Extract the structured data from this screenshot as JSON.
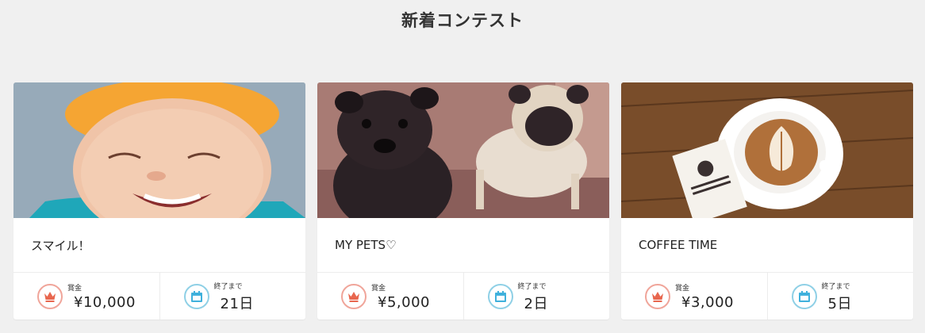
{
  "section_title": "新着コンテスト",
  "contests": [
    {
      "title": "スマイル！",
      "image_icon": "child-smiling-photo",
      "prize_label": "賞金",
      "prize": "¥10,000",
      "deadline_label": "終了まで",
      "deadline": "21日"
    },
    {
      "title": "MY PETS♡",
      "image_icon": "pug-dogs-photo",
      "prize_label": "賞金",
      "prize": "¥5,000",
      "deadline_label": "終了まで",
      "deadline": "2日"
    },
    {
      "title": "COFFEE TIME",
      "image_icon": "latte-coffee-photo",
      "prize_label": "賞金",
      "prize": "¥3,000",
      "deadline_label": "終了まで",
      "deadline": "5日"
    }
  ],
  "colors": {
    "background": "#f0f0f0",
    "prize_accent": "#e8674f",
    "calendar_accent": "#3fb1dc"
  }
}
